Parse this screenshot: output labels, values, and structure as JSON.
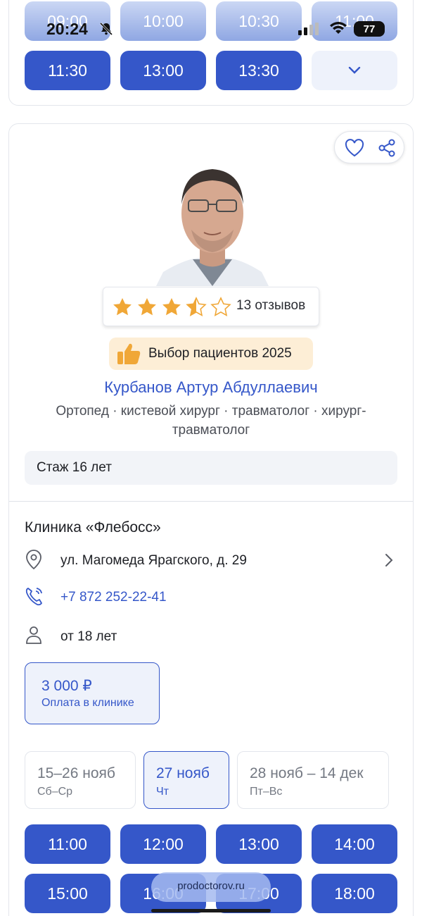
{
  "status_bar": {
    "time": "20:24",
    "battery": "77"
  },
  "top_slots": {
    "row1": [
      "09:00",
      "10:00",
      "10:30",
      "11:00"
    ],
    "row2": [
      "11:30",
      "13:00",
      "13:30"
    ],
    "more_icon": "chevron-down-icon"
  },
  "doctor": {
    "rating_value": 3.5,
    "reviews": "13 отзывов",
    "badge": "Выбор пациентов 2025",
    "name": "Курбанов Артур Абдуллаевич",
    "specialty_line1": "Ортопед · кистевой хирург · травматолог · хирург-",
    "specialty_line2": "травматолог",
    "experience": "Стаж 16 лет"
  },
  "clinic": {
    "name": "Клиника «Флебосс»",
    "address": "ул. Магомеда Ярагского, д. 29",
    "phone": "+7 872 252-22-41",
    "age": "от 18 лет",
    "price": "3 000 ₽",
    "payment": "Оплата в клинике"
  },
  "date_tabs": [
    {
      "range": "15–26 нояб",
      "days": "Сб–Ср"
    },
    {
      "range": "27 нояб",
      "days": "Чт"
    },
    {
      "range": "28 нояб – 14 дек",
      "days": "Пт–Вс"
    }
  ],
  "bottom_slots": {
    "row1": [
      "11:00",
      "12:00",
      "13:00",
      "14:00"
    ],
    "row2": [
      "15:00",
      "16:00",
      "17:00",
      "18:00"
    ]
  },
  "watermark": "prodoctorov.ru",
  "colors": {
    "accent": "#3557c9",
    "badge_bg": "#fdeed6",
    "star": "#f0a737"
  }
}
